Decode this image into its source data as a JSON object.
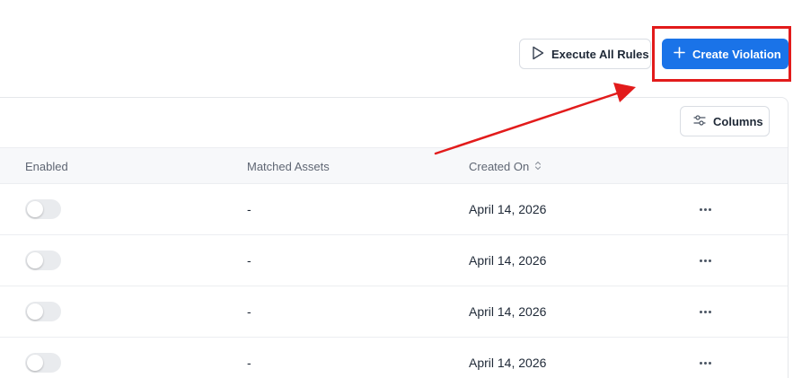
{
  "toolbar": {
    "execute_label": "Execute All Rules",
    "create_label": "Create Violation"
  },
  "table": {
    "columns_button_label": "Columns",
    "headers": {
      "enabled": "Enabled",
      "matched_assets": "Matched Assets",
      "created_on": "Created On"
    },
    "rows": [
      {
        "enabled": false,
        "matched_assets": "-",
        "created_on": "April 14, 2026"
      },
      {
        "enabled": false,
        "matched_assets": "-",
        "created_on": "April 14, 2026"
      },
      {
        "enabled": false,
        "matched_assets": "-",
        "created_on": "April 14, 2026"
      },
      {
        "enabled": false,
        "matched_assets": "-",
        "created_on": "April 14, 2026"
      }
    ]
  },
  "colors": {
    "primary": "#1a73e8",
    "annotation_red": "#e21b1b"
  },
  "icons": {
    "execute": "play-icon",
    "create": "plus-icon",
    "columns": "sliders-icon",
    "sort": "sort-icon",
    "row_actions": "more-horizontal-icon"
  }
}
